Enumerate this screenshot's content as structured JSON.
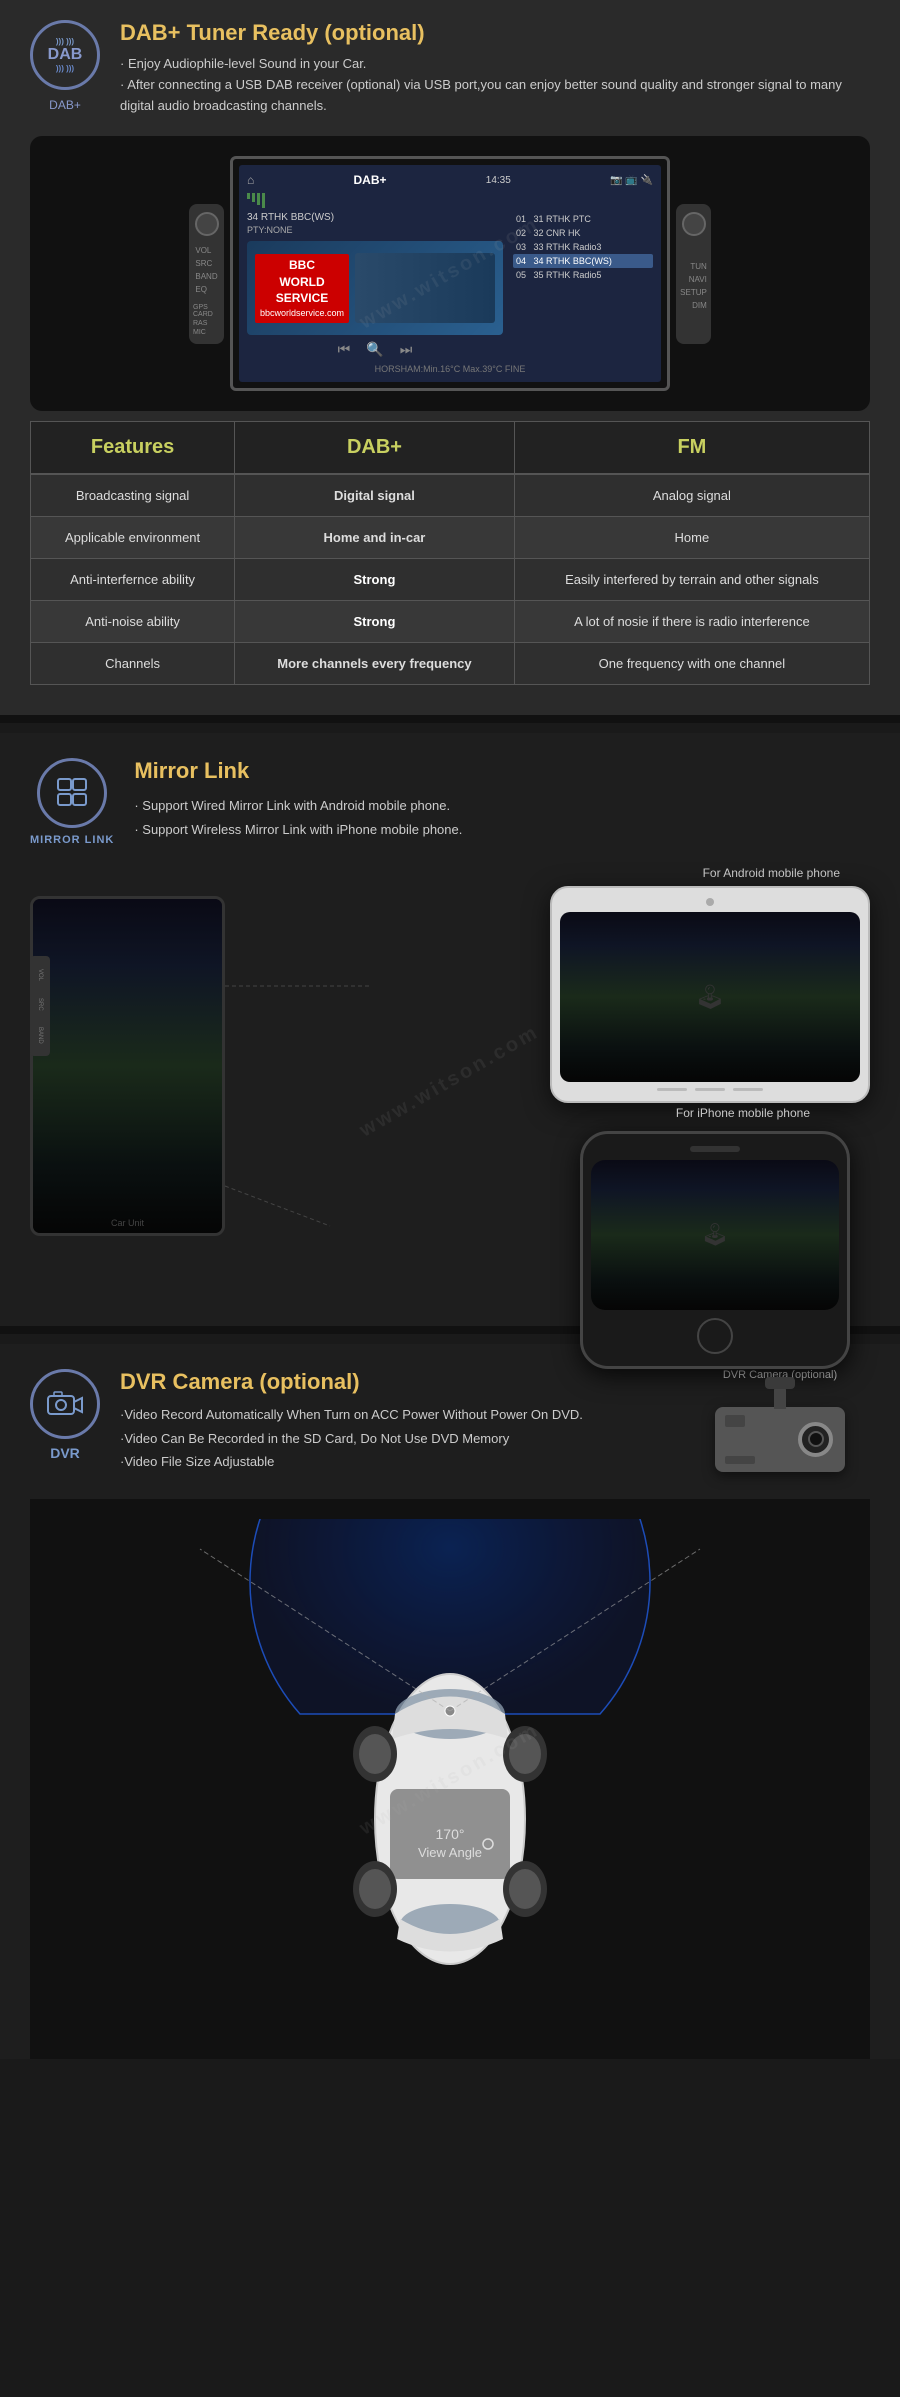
{
  "watermark": "www.witson.com",
  "dab": {
    "icon_text": "DAB",
    "icon_label": "DAB+",
    "title": "DAB+ Tuner Ready (optional)",
    "desc1": "· Enjoy Audiophile-level Sound in your Car.",
    "desc2": "· After connecting a USB DAB receiver (optional) via USB port,you can enjoy better sound quality and stronger signal to many digital audio broadcasting channels.",
    "device": {
      "title": "DAB+",
      "time": "14:35",
      "station": "34 RTHK BBC(WS)",
      "pty": "PTY:NONE",
      "bbc_line1": "BBC",
      "bbc_line2": "WORLD",
      "bbc_line3": "SERVICE",
      "bbc_url": "bbcworldservice.com",
      "channels": [
        {
          "num": "01",
          "name": "31 RTHK PTC"
        },
        {
          "num": "02",
          "name": "32 CNR HK"
        },
        {
          "num": "03",
          "name": "33 RTHK Radio3"
        },
        {
          "num": "04",
          "name": "34 RTHK BBC(WS)",
          "active": true
        },
        {
          "num": "05",
          "name": "35 RTHK Radio5"
        }
      ],
      "status": "HORSHAM:Min.16°C Max.39°C FINE"
    }
  },
  "table": {
    "headers": [
      "Features",
      "DAB+",
      "FM"
    ],
    "rows": [
      {
        "feature": "Broadcasting signal",
        "dab": "Digital signal",
        "fm": "Analog signal"
      },
      {
        "feature": "Applicable environment",
        "dab": "Home and in-car",
        "fm": "Home"
      },
      {
        "feature": "Anti-interfernce ability",
        "dab": "Strong",
        "fm": "Easily interfered by terrain and other signals"
      },
      {
        "feature": "Anti-noise ability",
        "dab": "Strong",
        "fm": "A lot of nosie if there is radio interference"
      },
      {
        "feature": "Channels",
        "dab": "More channels every frequency",
        "fm": "One frequency with one channel"
      }
    ]
  },
  "mirror": {
    "icon_label": "MIRROR LINK",
    "title": "Mirror Link",
    "desc1": "· Support Wired Mirror Link with Android mobile phone.",
    "desc2": "· Support Wireless Mirror Link with iPhone mobile phone.",
    "android_label": "For Android mobile phone",
    "iphone_label": "For iPhone mobile phone"
  },
  "dvr": {
    "icon_label": "DVR",
    "title": "DVR Camera (optional)",
    "desc1": "·Video Record Automatically When Turn on ACC Power Without Power On DVD.",
    "desc2": "·Video Can Be Recorded in the SD Card, Do Not Use DVD Memory",
    "desc3": "·Video File Size Adjustable",
    "camera_label": "DVR Camera (optional)",
    "angle_label": "170°",
    "angle_sub": "View Angle"
  }
}
